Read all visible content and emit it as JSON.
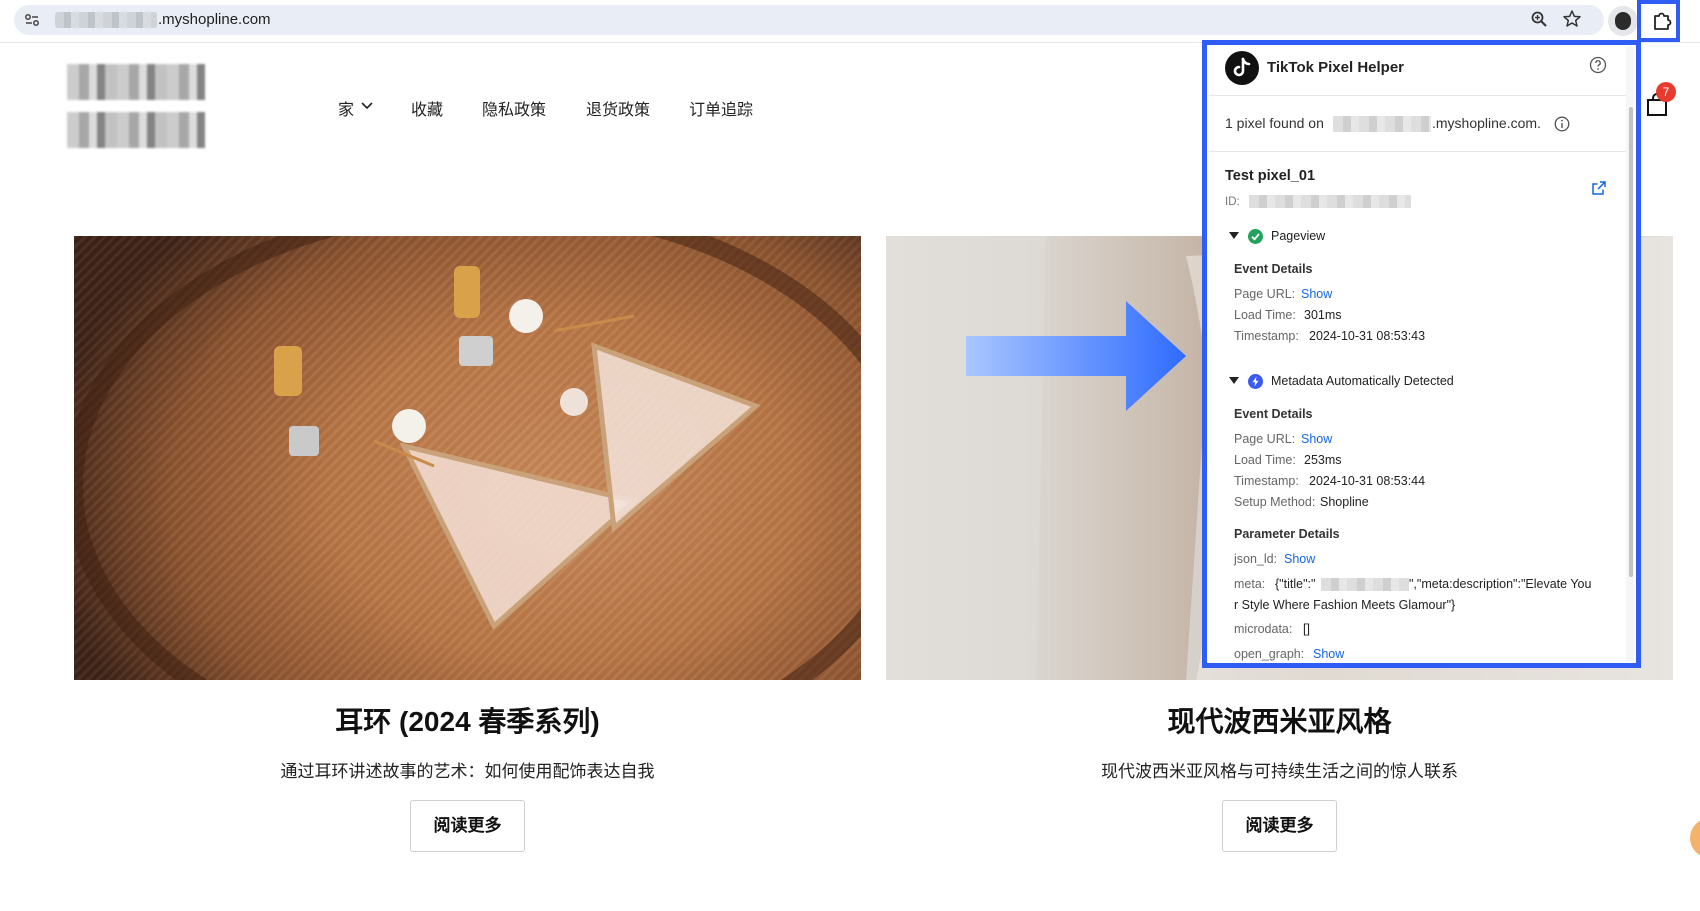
{
  "browser": {
    "url_domain": ".myshopline.com"
  },
  "nav": {
    "items": [
      {
        "label": "家"
      },
      {
        "label": "收藏"
      },
      {
        "label": "隐私政策"
      },
      {
        "label": "退货政策"
      },
      {
        "label": "订单追踪"
      }
    ]
  },
  "cart": {
    "count": "7"
  },
  "cards": [
    {
      "title": "耳环 (2024 春季系列)",
      "subtitle": "通过耳环讲述故事的艺术：如何使用配饰表达自我",
      "button": "阅读更多"
    },
    {
      "title": "现代波西米亚风格",
      "subtitle": "现代波西米亚风格与可持续生活之间的惊人联系",
      "button": "阅读更多"
    }
  ],
  "pixel_helper": {
    "title": "TikTok Pixel Helper",
    "found_prefix": "1 pixel found on",
    "found_suffix": ".myshopline.com.",
    "pixel_name": "Test pixel_01",
    "id_label": "ID:",
    "events": [
      {
        "name": "Pageview",
        "details_heading": "Event Details",
        "page_url_label": "Page URL:",
        "page_url_value": "Show",
        "load_time_label": "Load Time:",
        "load_time_value": "301ms",
        "timestamp_label": "Timestamp:",
        "timestamp_value": "2024-10-31 08:53:43"
      },
      {
        "name": "Metadata Automatically Detected",
        "details_heading": "Event Details",
        "page_url_label": "Page URL:",
        "page_url_value": "Show",
        "load_time_label": "Load Time:",
        "load_time_value": "253ms",
        "timestamp_label": "Timestamp:",
        "timestamp_value": "2024-10-31 08:53:44",
        "setup_method_label": "Setup Method:",
        "setup_method_value": "Shopline"
      }
    ],
    "parameters": {
      "heading": "Parameter Details",
      "json_ld_label": "json_ld:",
      "json_ld_value": "Show",
      "meta_label": "meta:",
      "meta_value_1": "{\"title\":\"",
      "meta_value_2": "\",\"meta:description\":\"Elevate You",
      "meta_value_3": "r Style Where Fashion Meets Glamour\"}",
      "microdata_label": "microdata:",
      "microdata_value": "[]",
      "open_graph_label": "open_graph:",
      "open_graph_value": "Show"
    }
  },
  "colors": {
    "highlight": "#2f5cf5",
    "link": "#1565e0",
    "badge": "#e63b2e",
    "success": "#22a45d"
  }
}
